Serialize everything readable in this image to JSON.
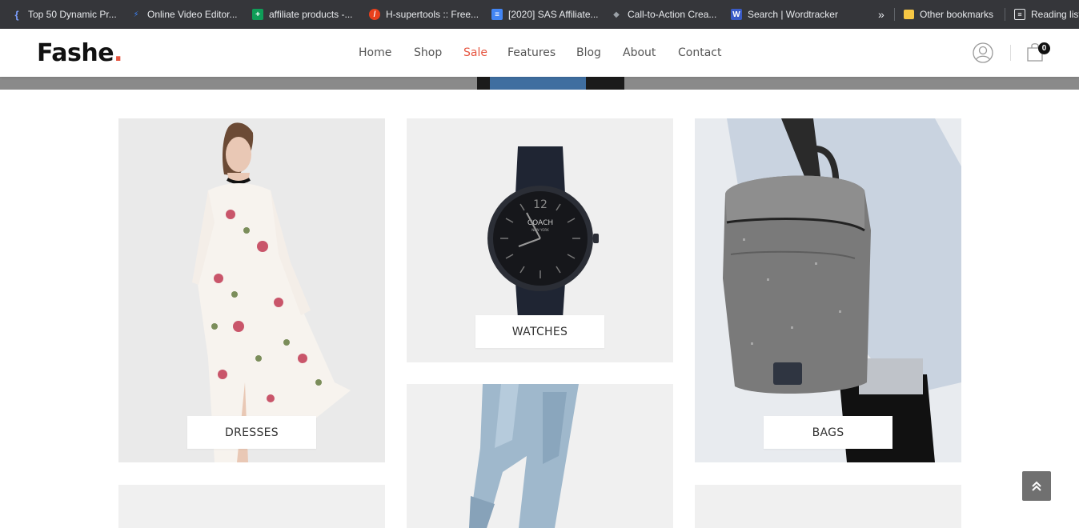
{
  "bookmarks": [
    {
      "label": "Top 50 Dynamic Pr...",
      "icon": "bracket-icon",
      "color": "#4a6fd1"
    },
    {
      "label": "Online Video Editor...",
      "icon": "lightning-icon",
      "color": "#3b82f6"
    },
    {
      "label": "affiliate products -...",
      "icon": "sheets-icon",
      "color": "#0f9d58"
    },
    {
      "label": "H-supertools :: Free...",
      "icon": "rocket-icon",
      "color": "#e8401c"
    },
    {
      "label": "[2020] SAS Affiliate...",
      "icon": "docs-icon",
      "color": "#4285f4"
    },
    {
      "label": "Call-to-Action Crea...",
      "icon": "diamond-icon",
      "color": "#202124"
    },
    {
      "label": "Search | Wordtracker",
      "icon": "w-icon",
      "color": "#3a5bc7"
    }
  ],
  "bookmarks_more": "»",
  "other_bookmarks": "Other bookmarks",
  "reading_list": "Reading list",
  "logo": {
    "text": "Fashe",
    "dot": ".",
    "dot_color": "#e65540"
  },
  "nav": [
    "Home",
    "Shop",
    "Sale",
    "Features",
    "Blog",
    "About",
    "Contact"
  ],
  "nav_active": "Sale",
  "cart_count": "0",
  "categories": [
    {
      "label": "DRESSES"
    },
    {
      "label": "WATCHES"
    },
    {
      "label": "BAGS"
    }
  ],
  "watch_brand": "COACH",
  "watch_sub": "NEW YORK",
  "watch_twelve": "12",
  "colors": {
    "accent": "#e65540",
    "card_bg": "#f0f0f0",
    "chrome_bg": "#35363a"
  }
}
